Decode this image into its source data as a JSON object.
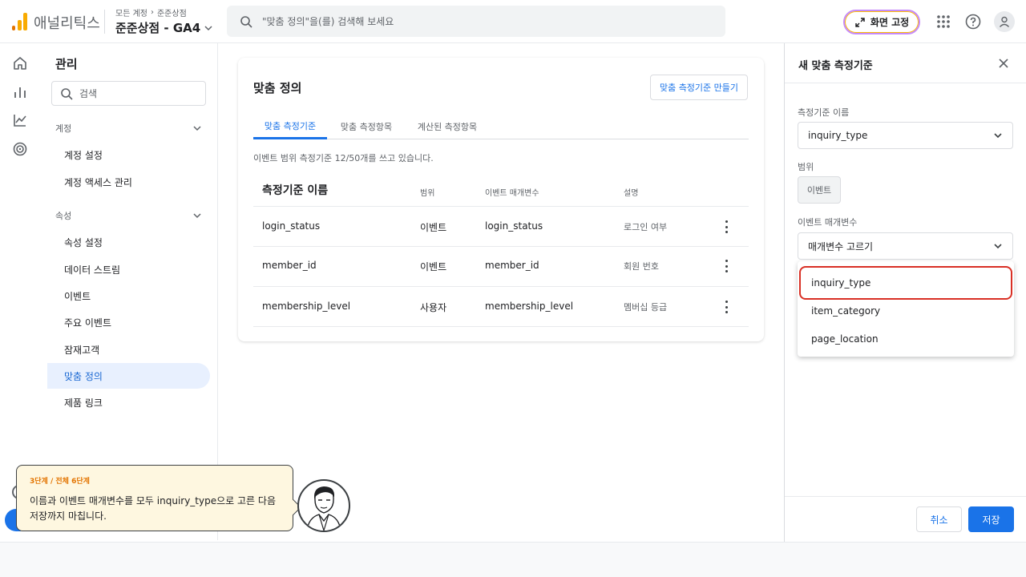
{
  "header": {
    "app_name": "애널리틱스",
    "breadcrumb": [
      "모든 계정",
      "준준상점"
    ],
    "property": "준준상점 - GA4",
    "search_placeholder": "\"맞춤 정의\"을(를) 검색해 보세요",
    "pin_label": "화면 고정"
  },
  "nav": {
    "title": "관리",
    "search_placeholder": "검색",
    "account_section": "계정",
    "account_items": [
      "계정 설정",
      "계정 액세스 관리"
    ],
    "property_section": "속성",
    "property_items": [
      "속성 설정",
      "데이터 스트림",
      "이벤트",
      "주요 이벤트",
      "잠재고객",
      "맞춤 정의",
      "제품 링크"
    ],
    "active_item": "맞춤 정의"
  },
  "main": {
    "title": "맞춤 정의",
    "create_button": "맞춤 측정기준 만들기",
    "tabs": [
      "맞춤 측정기준",
      "맞춤 측정항목",
      "계산된 측정항목"
    ],
    "active_tab": 0,
    "usage_text": "이벤트 범위 측정기준 12/50개를 쓰고 있습니다.",
    "columns": [
      "측정기준 이름",
      "범위",
      "이벤트 매개변수",
      "설명"
    ],
    "rows": [
      {
        "name": "login_status",
        "scope": "이벤트",
        "param": "login_status",
        "desc": "로그인 여부"
      },
      {
        "name": "member_id",
        "scope": "이벤트",
        "param": "member_id",
        "desc": "회원 번호"
      },
      {
        "name": "membership_level",
        "scope": "사용자",
        "param": "membership_level",
        "desc": "멤버십 등급"
      }
    ]
  },
  "panel": {
    "title": "새 맞춤 측정기준",
    "name_label": "측정기준 이름",
    "name_value": "inquiry_type",
    "scope_label": "범위",
    "scope_value": "이벤트",
    "param_label": "이벤트 매개변수",
    "param_placeholder": "매개변수 고르기",
    "options": [
      "inquiry_type",
      "item_category",
      "page_location"
    ],
    "highlighted_option": "inquiry_type",
    "cancel": "취소",
    "save": "저장"
  },
  "tutorial": {
    "step": "3단계 / 전체 6단계",
    "message_line1": "이름과 이벤트 매개변수를 모두 inquiry_type으로 고른 다음",
    "message_line2": "저장까지 마칩니다."
  },
  "colors": {
    "accent": "#1a73e8",
    "highlight": "#d93025",
    "logo": "#f9ab00",
    "tutorial_bg": "#fef7e0",
    "step_text": "#e37400"
  }
}
